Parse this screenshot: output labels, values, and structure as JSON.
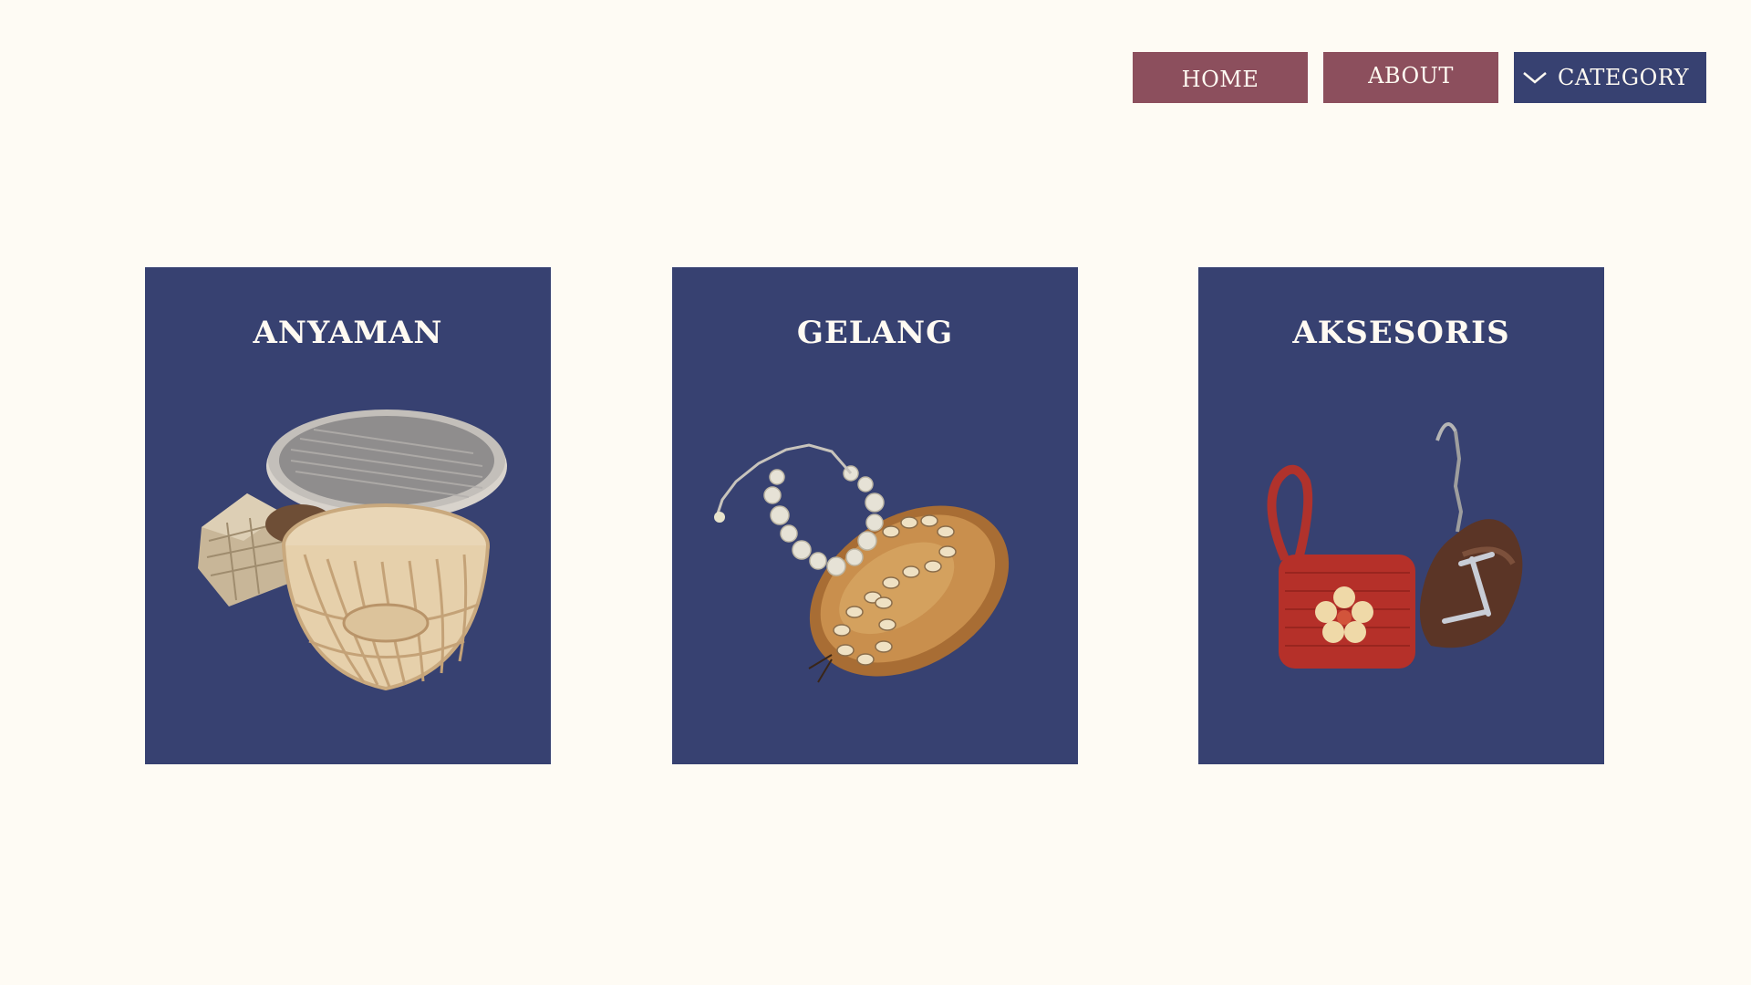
{
  "nav": {
    "home_label": "HOME",
    "about_label": "ABOUT",
    "category_label": "CATEGORY",
    "category_icon": "chevron-down-icon"
  },
  "categories": [
    {
      "title": "ANYAMAN",
      "image": "woven-baskets-image"
    },
    {
      "title": "GELANG",
      "image": "bracelets-image"
    },
    {
      "title": "AKSESORIS",
      "image": "accessories-image"
    }
  ],
  "colors": {
    "background": "#fefbf4",
    "nav_primary": "#8c4f5d",
    "nav_active": "#374171",
    "card": "#374171",
    "text_light": "#fffaf2"
  }
}
